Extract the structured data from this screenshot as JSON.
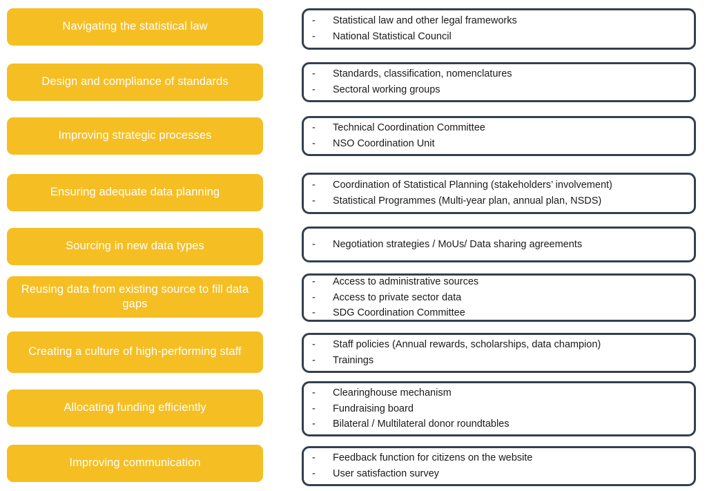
{
  "diagram": {
    "type": "two-column-mapping",
    "colors": {
      "topic_fill": "#f5be23",
      "topic_text": "#ffffff",
      "detail_border": "#333f50",
      "detail_fill": "#ffffff",
      "detail_text": "#1a1a1a",
      "page_background": "#ffffff"
    },
    "rows": [
      {
        "topic": "Navigating the statistical law",
        "details": [
          "Statistical law and other legal frameworks",
          "National Statistical Council"
        ]
      },
      {
        "topic": "Design and compliance of standards",
        "details": [
          "Standards, classification, nomenclatures",
          "Sectoral working groups"
        ]
      },
      {
        "topic": "Improving strategic processes",
        "details": [
          "Technical Coordination Committee",
          "NSO Coordination Unit"
        ]
      },
      {
        "topic": "Ensuring adequate data planning",
        "details": [
          "Coordination of Statistical Planning (stakeholders’ involvement)",
          "Statistical Programmes (Multi-year plan, annual plan, NSDS)"
        ]
      },
      {
        "topic": "Sourcing in new data types",
        "details": [
          "Negotiation strategies / MoUs/ Data sharing agreements"
        ]
      },
      {
        "topic": "Reusing data from existing source to fill data gaps",
        "details": [
          "Access to administrative sources",
          "Access to private sector data",
          "SDG Coordination Committee"
        ]
      },
      {
        "topic": "Creating a culture of high-performing staff",
        "details": [
          "Staff policies (Annual rewards, scholarships, data champion)",
          "Trainings"
        ]
      },
      {
        "topic": "Allocating funding efficiently",
        "details": [
          "Clearinghouse mechanism",
          "Fundraising board",
          "Bilateral / Multilateral donor roundtables"
        ]
      },
      {
        "topic": "Improving communication",
        "details": [
          "Feedback function for citizens on the website",
          "User satisfaction survey"
        ]
      }
    ],
    "bullet_marker": "-"
  }
}
